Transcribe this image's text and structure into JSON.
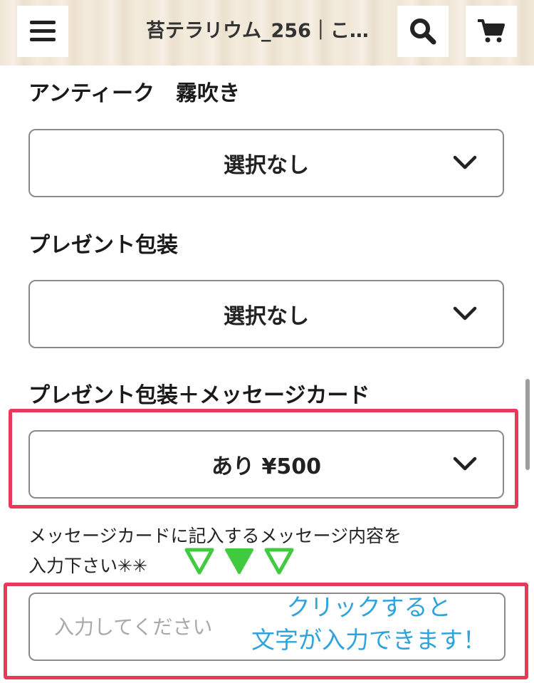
{
  "header": {
    "title": "苔テラリウム_256｜こ…",
    "menu_icon": "hamburger-menu-icon",
    "search_icon": "search-icon",
    "cart_icon": "cart-icon"
  },
  "options": [
    {
      "label": "アンティーク　霧吹き",
      "selected": "選択なし"
    },
    {
      "label": "プレゼント包装",
      "selected": "選択なし"
    },
    {
      "label": "プレゼント包装＋メッセージカード",
      "selected": "あり ¥500"
    }
  ],
  "message": {
    "instruction_line1": "メッセージカードに記入するメッセージ内容を",
    "instruction_line2": "入力下さい✳︎✳︎",
    "placeholder": "入力してください",
    "hint_line1": "クリックすると",
    "hint_line2": "文字が入力できます！"
  },
  "colors": {
    "highlight": "#e8395a",
    "hint_text": "#2ea3dc",
    "triangle": "#3fca3f"
  }
}
